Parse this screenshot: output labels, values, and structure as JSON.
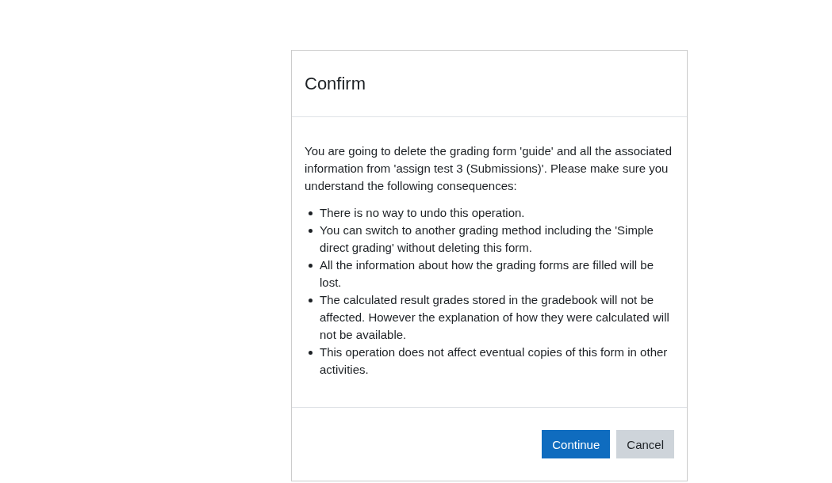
{
  "dialog": {
    "title": "Confirm",
    "message": "You are going to delete the grading form 'guide' and all the associated information from 'assign test 3 (Submissions)'. Please make sure you understand the following consequences:",
    "consequences": [
      "There is no way to undo this operation.",
      "You can switch to another grading method including the 'Simple direct grading' without deleting this form.",
      "All the information about how the grading forms are filled will be lost.",
      "The calculated result grades stored in the gradebook will not be affected. However the explanation of how they were calculated will not be available.",
      "This operation does not affect eventual copies of this form in other activities."
    ],
    "buttons": [
      {
        "label": "Continue",
        "kind": "primary"
      },
      {
        "label": "Cancel",
        "kind": "secondary"
      }
    ]
  }
}
